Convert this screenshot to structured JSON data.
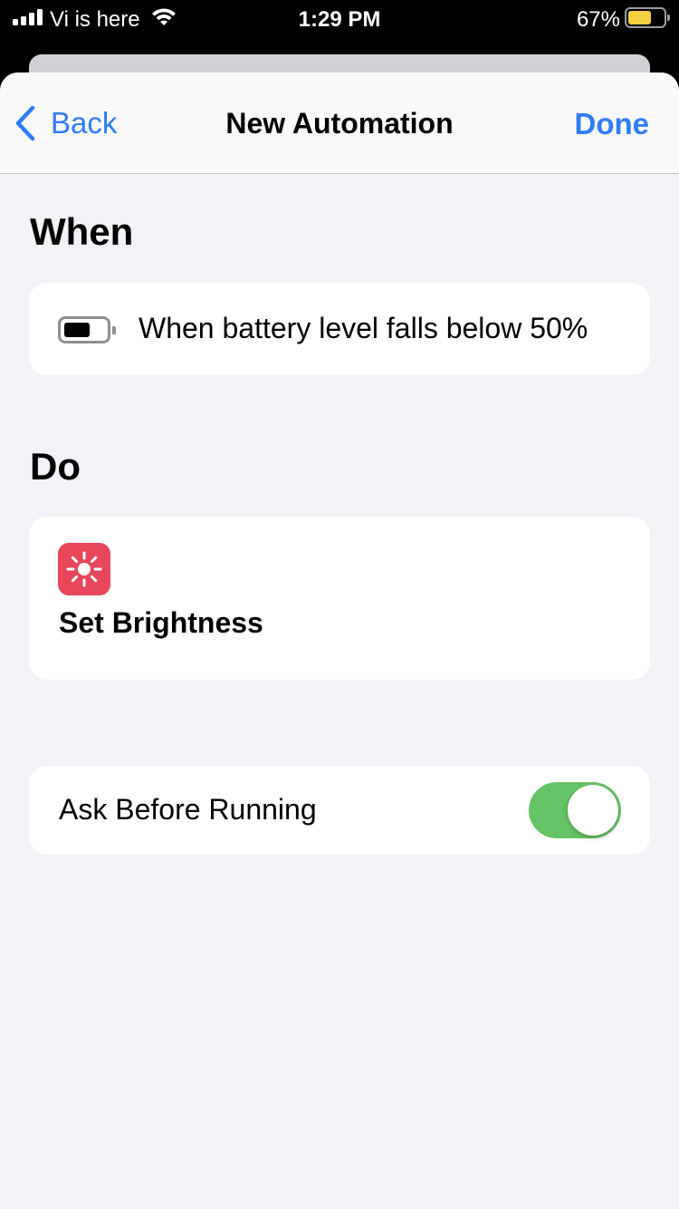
{
  "status_bar": {
    "carrier": "Vi is here",
    "time": "1:29 PM",
    "battery_percent_label": "67%",
    "battery_level": 0.67,
    "battery_fill_color": "#f5d042",
    "signal_icon": "cellular-signal-icon",
    "wifi_icon": "wifi-icon"
  },
  "navbar": {
    "back_label": "Back",
    "back_icon": "chevron-left-icon",
    "title": "New Automation",
    "done_label": "Done",
    "accent_color": "#2e7cf6"
  },
  "when_section": {
    "header": "When",
    "trigger": {
      "icon": "battery-icon",
      "text": "When battery level falls below 50%"
    }
  },
  "do_section": {
    "header": "Do",
    "action": {
      "icon": "sun-brightness-icon",
      "icon_bg_color": "#e8475b",
      "label": "Set Brightness"
    }
  },
  "settings": {
    "ask_before_running": {
      "label": "Ask Before Running",
      "enabled": true,
      "toggle_on_color": "#65c466"
    }
  }
}
